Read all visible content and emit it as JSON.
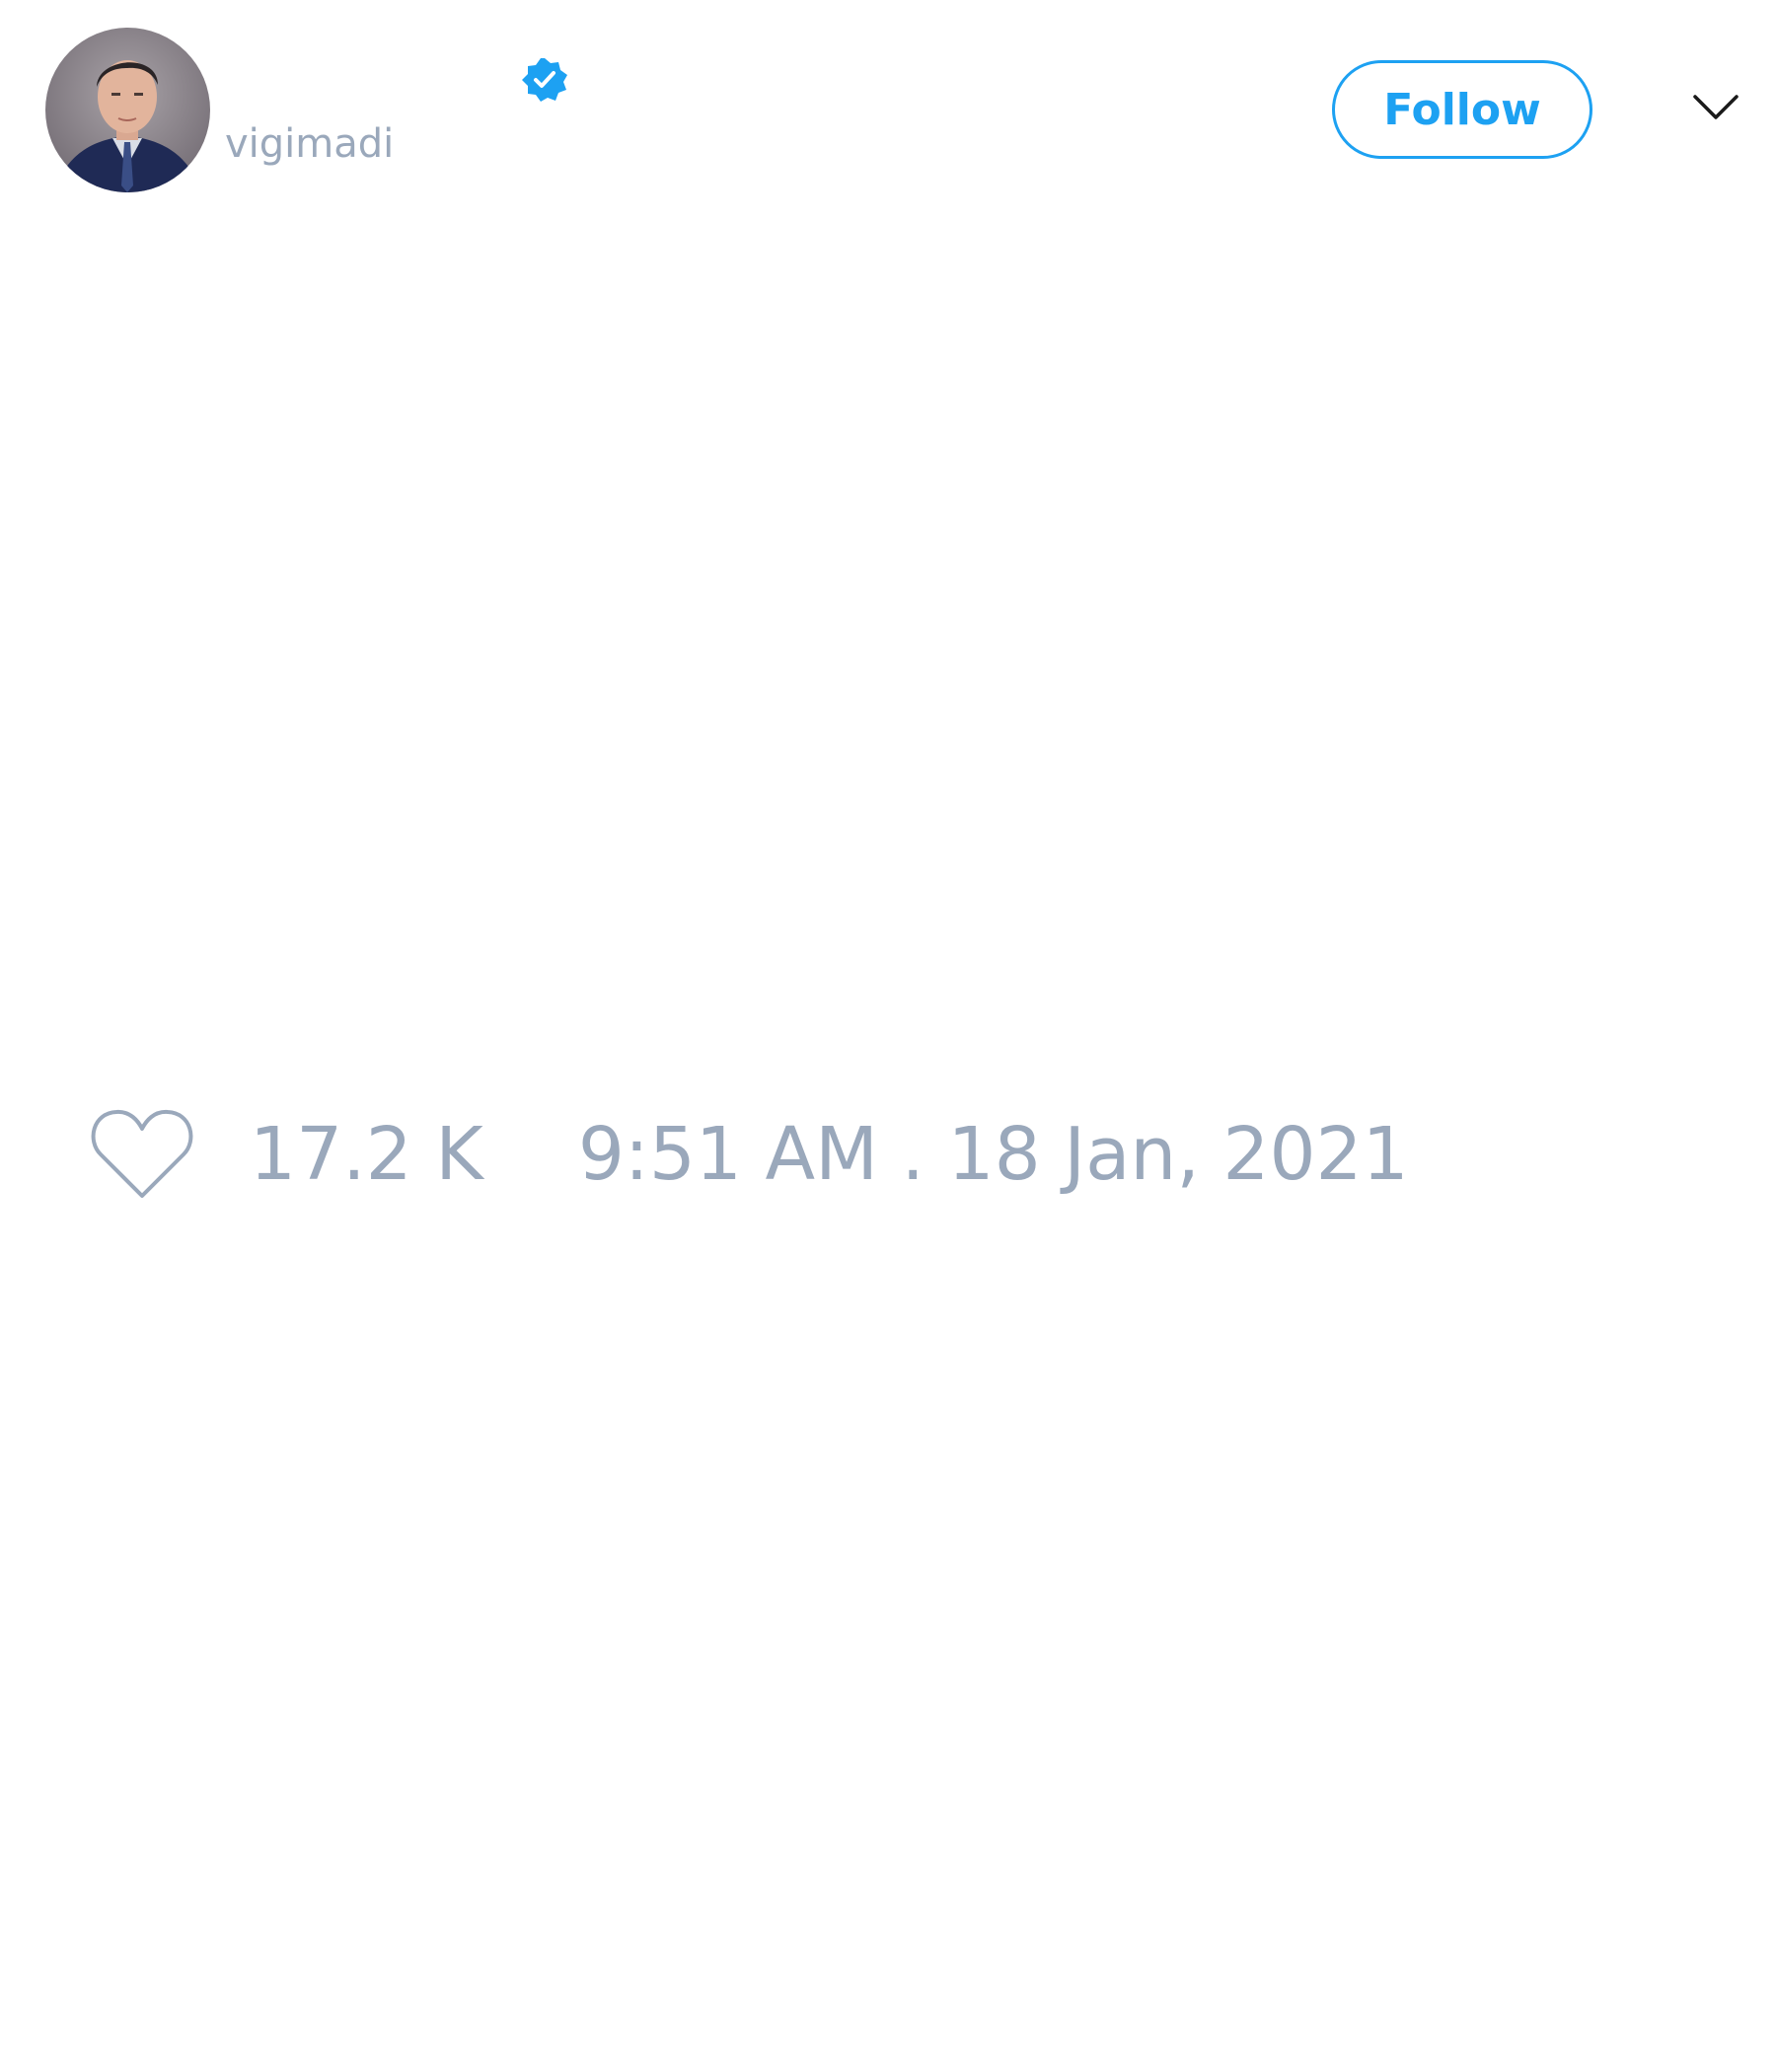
{
  "tweet": {
    "author": {
      "handle": "vigimadi",
      "verified": true,
      "avatar": "profile-photo"
    },
    "follow_label": "Follow",
    "menu_icon": "chevron-down-icon",
    "likes": {
      "icon": "heart-icon",
      "count": "17.2 K"
    },
    "timestamp": "9:51 AM . 18 Jan, 2021"
  },
  "colors": {
    "accent": "#1da1f2",
    "muted_text": "#9aa8bb",
    "background": "#ffffff"
  }
}
